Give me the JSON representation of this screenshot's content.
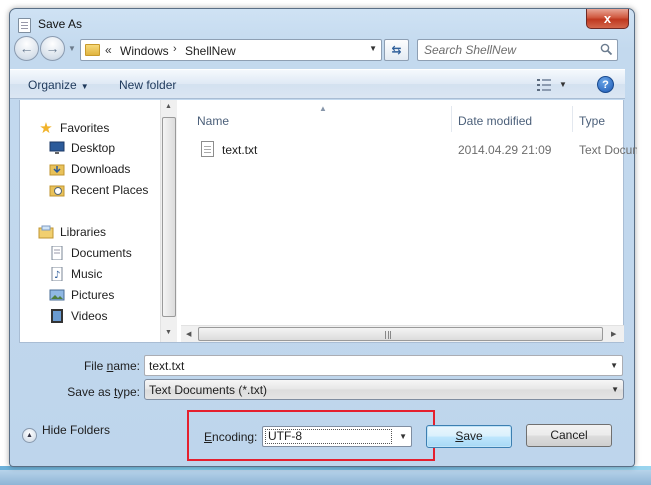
{
  "window": {
    "title": "Save As",
    "close_glyph": "x"
  },
  "address": {
    "prefix": "«",
    "segments": [
      "Windows",
      "ShellNew"
    ],
    "separator": "›"
  },
  "search": {
    "placeholder": "Search ShellNew"
  },
  "toolbar": {
    "organize_label": "Organize",
    "new_folder_label": "New folder",
    "help_glyph": "?"
  },
  "nav": {
    "favorites_label": "Favorites",
    "favorites": [
      "Desktop",
      "Downloads",
      "Recent Places"
    ],
    "libraries_label": "Libraries",
    "libraries": [
      "Documents",
      "Music",
      "Pictures",
      "Videos"
    ]
  },
  "columns": {
    "name": "Name",
    "date": "Date modified",
    "type": "Type"
  },
  "files": [
    {
      "name": "text.txt",
      "date": "2014.04.29 21:09",
      "type": "Text Document"
    }
  ],
  "form": {
    "file_name_label_pre": "File ",
    "file_name_label_key": "n",
    "file_name_label_post": "ame:",
    "file_name_value": "text.txt",
    "save_type_label_pre": "Save as ",
    "save_type_label_key": "t",
    "save_type_label_post": "ype:",
    "save_type_value": "Text Documents (*.txt)",
    "hide_folders_label": "Hide Folders",
    "encoding_label_pre": "",
    "encoding_label_key": "E",
    "encoding_label_post": "ncoding:",
    "encoding_value": "UTF-8",
    "save_label_key": "S",
    "save_label_post": "ave",
    "cancel_label": "Cancel"
  },
  "colors": {
    "highlight_box": "#e5202e",
    "default_button": "#bee6fd"
  }
}
